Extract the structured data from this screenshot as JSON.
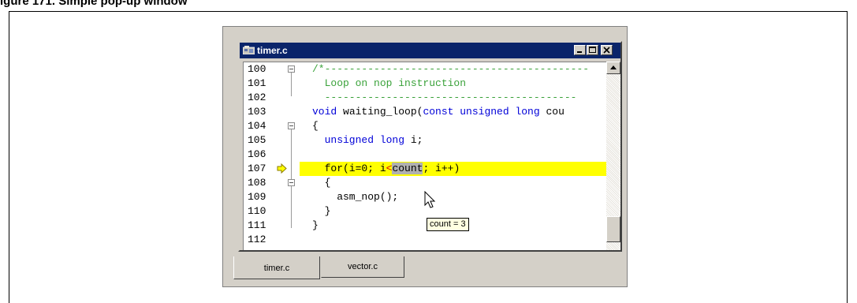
{
  "heading": "igure 171. Simple pop-up window",
  "window": {
    "title": "timer.c",
    "controls": [
      "minimize-button",
      "maximize-button",
      "close-button"
    ]
  },
  "code_lines": [
    {
      "num": "100",
      "text": "/*-------------------------------------------",
      "color": "green"
    },
    {
      "num": "101",
      "text": "  Loop on nop instruction",
      "color": "green"
    },
    {
      "num": "102",
      "text": "  -----------------------------------------",
      "color": "green"
    },
    {
      "num": "103",
      "pre": "void ",
      "mid": "waiting_loop(",
      "kw": "const unsigned long ",
      "post": "cou"
    },
    {
      "num": "104",
      "text": "{",
      "color": "black"
    },
    {
      "num": "105",
      "kwtext": "  unsigned long ",
      "post": "i;"
    },
    {
      "num": "106",
      "text": "",
      "color": "black"
    },
    {
      "num": "107",
      "a": "  for(i=0; i",
      "lt": "<",
      "sel": "count",
      "b": "; i++)",
      "highlighted": true
    },
    {
      "num": "108",
      "text": "  {",
      "color": "black"
    },
    {
      "num": "109",
      "text": "    asm_nop();",
      "color": "black"
    },
    {
      "num": "110",
      "text": "  }",
      "color": "black"
    },
    {
      "num": "111",
      "text": "}",
      "color": "black"
    },
    {
      "num": "112",
      "text": "",
      "color": "black"
    }
  ],
  "tooltip": "count = 3",
  "tabs": [
    {
      "label": "timer.c",
      "active": true
    },
    {
      "label": "vector.c",
      "active": false
    }
  ],
  "colors": {
    "titlebar": "#0a246a",
    "highlight": "#ffff00",
    "comment": "#3aa23a",
    "keyword": "#0000d8"
  },
  "icons": [
    "window-icon",
    "current-line-arrow-icon",
    "mouse-pointer-icon",
    "scroll-up-arrow-icon"
  ]
}
